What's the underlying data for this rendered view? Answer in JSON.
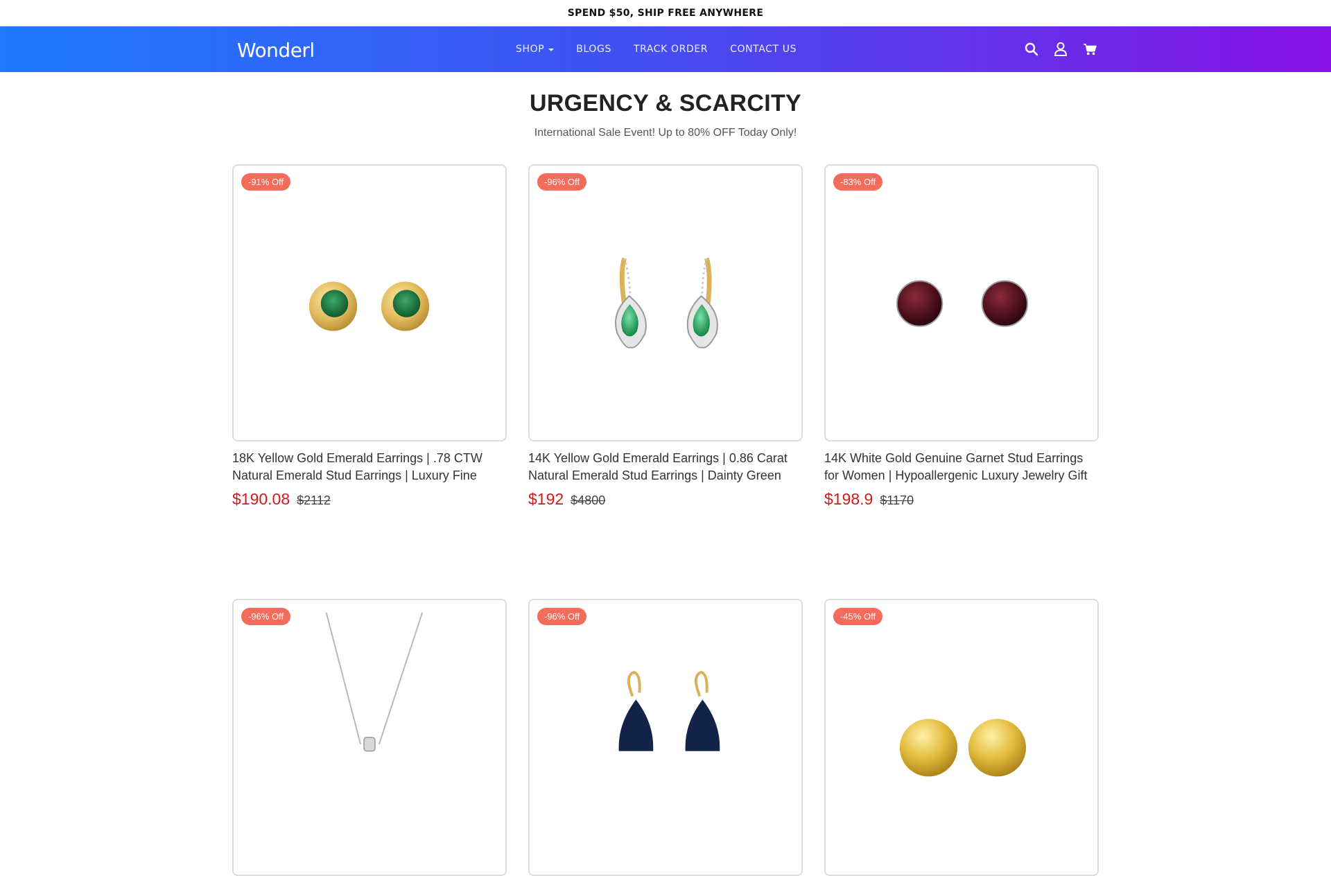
{
  "announcement": "SPEND $50, SHIP FREE ANYWHERE",
  "brand": {
    "logo": "Wonderl"
  },
  "nav": {
    "links": [
      {
        "label": "SHOP",
        "has_dropdown": true
      },
      {
        "label": "BLOGS"
      },
      {
        "label": "TRACK ORDER"
      },
      {
        "label": "CONTACT US"
      }
    ],
    "icons": [
      "search-icon",
      "account-icon",
      "cart-icon"
    ]
  },
  "section": {
    "title": "URGENCY & SCARCITY",
    "subtitle": "International Sale Event! Up to 80% OFF Today Only!"
  },
  "products": [
    {
      "badge": "-91% Off",
      "title": "18K Yellow Gold Emerald Earrings | .78 CTW Natural Emerald Stud Earrings | Luxury Fine",
      "price": "$190.08",
      "compare_price": "$2112"
    },
    {
      "badge": "-96% Off",
      "title": "14K Yellow Gold Emerald Earrings | 0.86 Carat Natural Emerald Stud Earrings | Dainty Green",
      "price": "$192",
      "compare_price": "$4800"
    },
    {
      "badge": "-83% Off",
      "title": "14K White Gold Genuine Garnet Stud Earrings for Women | Hypoallergenic Luxury Jewelry Gift",
      "price": "$198.9",
      "compare_price": "$1170"
    },
    {
      "badge": "-96% Off"
    },
    {
      "badge": "-96% Off"
    },
    {
      "badge": "-45% Off"
    }
  ],
  "colors": {
    "gradient_start": "#1f7bff",
    "gradient_end": "#8a12e6",
    "badge": "#f26b5b",
    "price": "#d11a1a"
  }
}
